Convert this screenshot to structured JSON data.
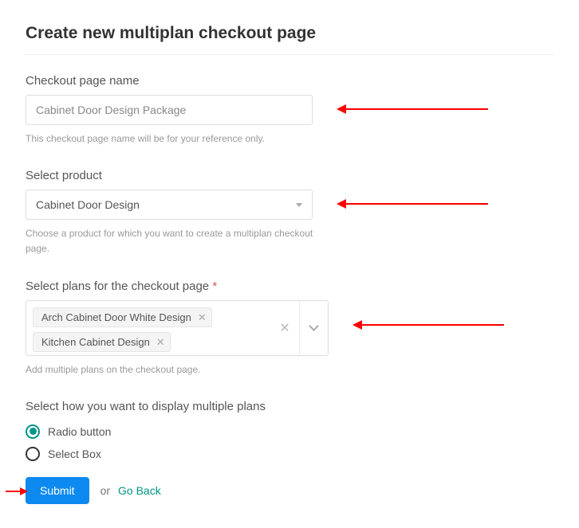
{
  "title": "Create new multiplan checkout page",
  "fields": {
    "name": {
      "label": "Checkout page name",
      "value": "Cabinet Door Design Package",
      "help": "This checkout page name will be for your reference only."
    },
    "product": {
      "label": "Select product",
      "value": "Cabinet Door Design",
      "help": "Choose a product for which you want to create a multiplan checkout page."
    },
    "plans": {
      "label": "Select plans for the checkout page",
      "required_mark": "*",
      "tags": [
        "Arch Cabinet Door White Design",
        "Kitchen Cabinet Design"
      ],
      "help": "Add multiple plans on the checkout page."
    },
    "display": {
      "label": "Select how you want to display multiple plans",
      "options": [
        {
          "label": "Radio button",
          "selected": true
        },
        {
          "label": "Select Box",
          "selected": false
        }
      ]
    }
  },
  "actions": {
    "submit": "Submit",
    "or": "or",
    "go_back": "Go Back"
  }
}
